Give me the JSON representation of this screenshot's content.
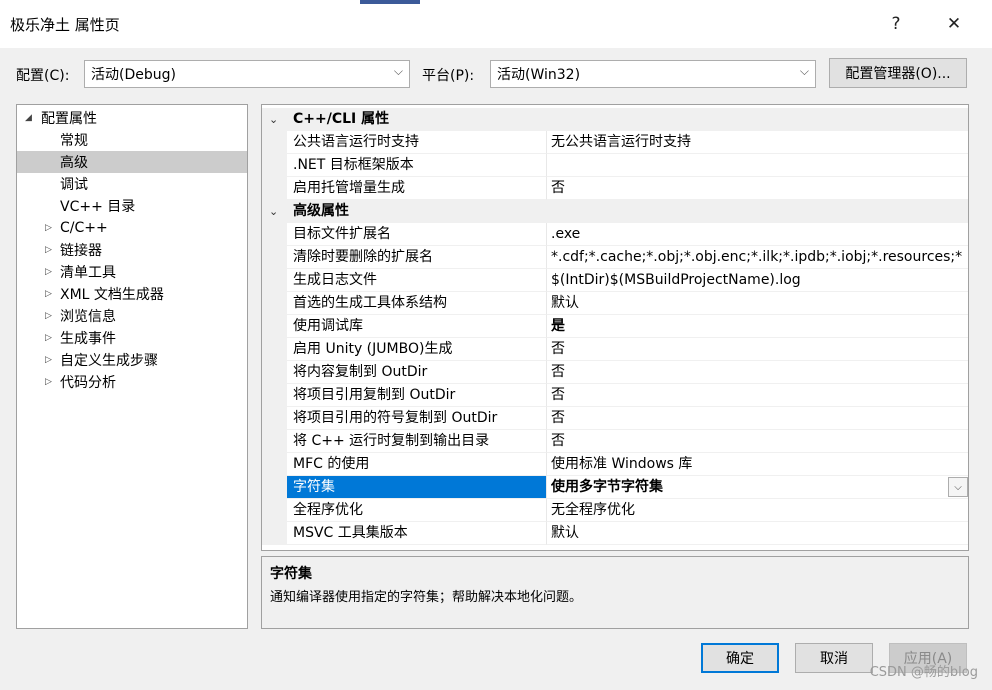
{
  "window": {
    "title": "极乐净土 属性页",
    "help": "?",
    "close": "✕"
  },
  "config_row": {
    "config_label": "配置(C):",
    "config_value": "活动(Debug)",
    "platform_label": "平台(P):",
    "platform_value": "活动(Win32)",
    "manager_button": "配置管理器(O)..."
  },
  "tree": {
    "items": [
      {
        "label": "配置属性",
        "twisty": "◢"
      },
      {
        "label": "常规"
      },
      {
        "label": "高级"
      },
      {
        "label": "调试"
      },
      {
        "label": "VC++ 目录"
      },
      {
        "label": "C/C++",
        "twisty": "▷"
      },
      {
        "label": "链接器",
        "twisty": "▷"
      },
      {
        "label": "清单工具",
        "twisty": "▷"
      },
      {
        "label": "XML 文档生成器",
        "twisty": "▷"
      },
      {
        "label": "浏览信息",
        "twisty": "▷"
      },
      {
        "label": "生成事件",
        "twisty": "▷"
      },
      {
        "label": "自定义生成步骤",
        "twisty": "▷"
      },
      {
        "label": "代码分析",
        "twisty": "▷"
      }
    ]
  },
  "grid": {
    "categories": [
      {
        "title": "C++/CLI 属性",
        "chevron": "⌄",
        "rows": [
          {
            "name": "公共语言运行时支持",
            "value": "无公共语言运行时支持"
          },
          {
            "name": ".NET 目标框架版本",
            "value": ""
          },
          {
            "name": "启用托管增量生成",
            "value": "否"
          }
        ]
      },
      {
        "title": "高级属性",
        "chevron": "⌄",
        "rows": [
          {
            "name": "目标文件扩展名",
            "value": ".exe"
          },
          {
            "name": "清除时要删除的扩展名",
            "value": "*.cdf;*.cache;*.obj;*.obj.enc;*.ilk;*.ipdb;*.iobj;*.resources;*"
          },
          {
            "name": "生成日志文件",
            "value": "$(IntDir)$(MSBuildProjectName).log"
          },
          {
            "name": "首选的生成工具体系结构",
            "value": "默认"
          },
          {
            "name": "使用调试库",
            "value": "是"
          },
          {
            "name": "启用 Unity (JUMBO)生成",
            "value": "否"
          },
          {
            "name": "将内容复制到 OutDir",
            "value": "否"
          },
          {
            "name": "将项目引用复制到 OutDir",
            "value": "否"
          },
          {
            "name": "将项目引用的符号复制到 OutDir",
            "value": "否"
          },
          {
            "name": "将 C++ 运行时复制到输出目录",
            "value": "否"
          },
          {
            "name": "MFC 的使用",
            "value": "使用标准 Windows 库"
          },
          {
            "name": "字符集",
            "value": "使用多字节字符集"
          },
          {
            "name": "全程序优化",
            "value": "无全程序优化"
          },
          {
            "name": "MSVC 工具集版本",
            "value": "默认"
          }
        ]
      }
    ]
  },
  "description": {
    "title": "字符集",
    "text": "通知编译器使用指定的字符集；帮助解决本地化问题。"
  },
  "buttons": {
    "ok": "确定",
    "cancel": "取消",
    "apply": "应用(A)"
  },
  "watermark": "CSDN @畅的blog"
}
